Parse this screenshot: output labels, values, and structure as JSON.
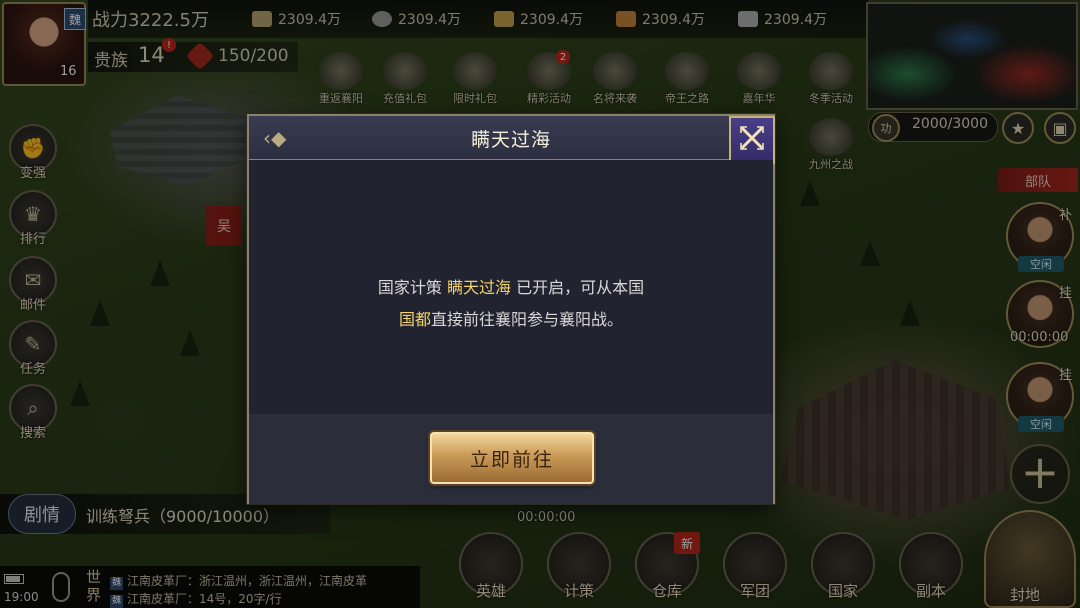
{
  "hero": {
    "kingdom": "魏",
    "level": "16"
  },
  "top": {
    "power_label": "战力",
    "power_value": "3222.5万",
    "resources": [
      "2309.4万",
      "2309.4万",
      "2309.4万",
      "2309.4万",
      "2309.4万"
    ]
  },
  "noble": {
    "label": "贵族",
    "level": "14",
    "alert": "!",
    "stamina": "150/200"
  },
  "events": [
    {
      "label": "重返襄阳",
      "badge": ""
    },
    {
      "label": "充值礼包",
      "badge": ""
    },
    {
      "label": "限时礼包",
      "badge": ""
    },
    {
      "label": "精彩活动",
      "badge": "2"
    },
    {
      "label": "名将来袭",
      "badge": ""
    },
    {
      "label": "帝王之路",
      "badge": ""
    },
    {
      "label": "嘉年华",
      "badge": ""
    },
    {
      "label": "冬季活动",
      "badge": ""
    }
  ],
  "event_timer": "00:00:00",
  "minimap": {
    "troop_count": "2000/3000",
    "troop_badge": "功"
  },
  "jiuzhou_label": "九州之战",
  "troops_tab": "部队",
  "generals": [
    {
      "tag": "补",
      "state": "空闲"
    },
    {
      "tag": "挂",
      "state": ""
    },
    {
      "tag": "挂",
      "state": "空闲"
    }
  ],
  "general_timer": "00:00:00",
  "side_menu": [
    "变强",
    "排行",
    "邮件",
    "任务",
    "搜索"
  ],
  "map_flag": "吴",
  "dialog": {
    "title": "瞒天过海",
    "line1_prefix": "国家计策 ",
    "line1_highlight": "瞒天过海",
    "line1_suffix": " 已开启，可从本国",
    "line2_highlight": "国都",
    "line2_suffix": "直接前往襄阳参与襄阳战。",
    "button": "立即前往"
  },
  "quest": {
    "tag": "剧情",
    "text": "训练弩兵（9000/10000）"
  },
  "map_timer": "00:00:00",
  "chat": {
    "clock": "19:00",
    "channel": "世界",
    "lines": [
      "江南皮革厂：浙江温州，浙江温州，江南皮革",
      "江南皮革厂：14号，20字/行"
    ],
    "kingdom_badge": "魏"
  },
  "bottom_nav": [
    "英雄",
    "计策",
    "仓库",
    "军团",
    "国家",
    "副本"
  ],
  "new_badge": "新",
  "fief_label": "封地",
  "colors": {
    "accent_gold": "#f2d36a",
    "button_gold": "#c99a57",
    "dialog_bg": "#22222c",
    "alert_red": "#c0261d"
  }
}
